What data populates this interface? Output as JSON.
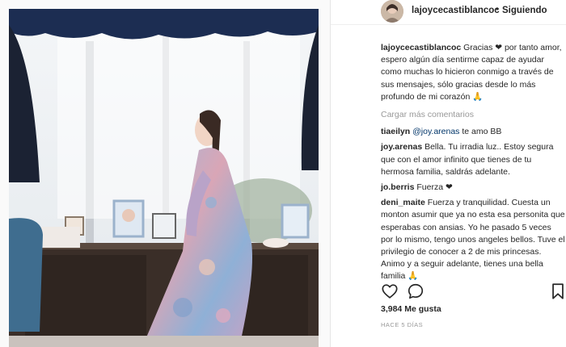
{
  "post": {
    "header": {
      "username": "lajoycecastiblancoc",
      "separator": "•",
      "follow_status": "Siguiendo"
    },
    "caption": {
      "username": "lajoycecastiblancoc",
      "text": "Gracias ❤ por tanto amor, espero algún día sentirme capaz de ayudar como muchas lo hicieron conmigo a través de sus mensajes, sólo gracias desde lo más profundo de mi corazón 🙏"
    },
    "load_more_label": "Cargar más comentarios",
    "comments": [
      {
        "username": "tiaeilyn",
        "mention": "@joy.arenas",
        "text": " te amo BB"
      },
      {
        "username": "joy.arenas",
        "mention": "",
        "text": "Bella. Tu irradia luz.. Estoy segura que con el amor infinito que tienes de tu hermosa familia, saldrás adelante."
      },
      {
        "username": "jo.berris",
        "mention": "",
        "text": "Fuerza ❤"
      },
      {
        "username": "deni_maite",
        "mention": "",
        "text": "Fuerza y tranquilidad. Cuesta un monton asumir que ya no esta esa personita que esperabas con ansias. Yo he pasado 5 veces por lo mismo, tengo unos angeles bellos. Tuve el privilegio de conocer a 2 de mis princesas. Animo y a seguir adelante, tienes una bella familia 🙏"
      }
    ],
    "actions": {
      "like_icon": "heart-outline-icon",
      "comment_icon": "speech-bubble-icon",
      "save_icon": "bookmark-icon"
    },
    "likes_label": "3,984 Me gusta",
    "timestamp": "HACE 5 DÍAS"
  }
}
